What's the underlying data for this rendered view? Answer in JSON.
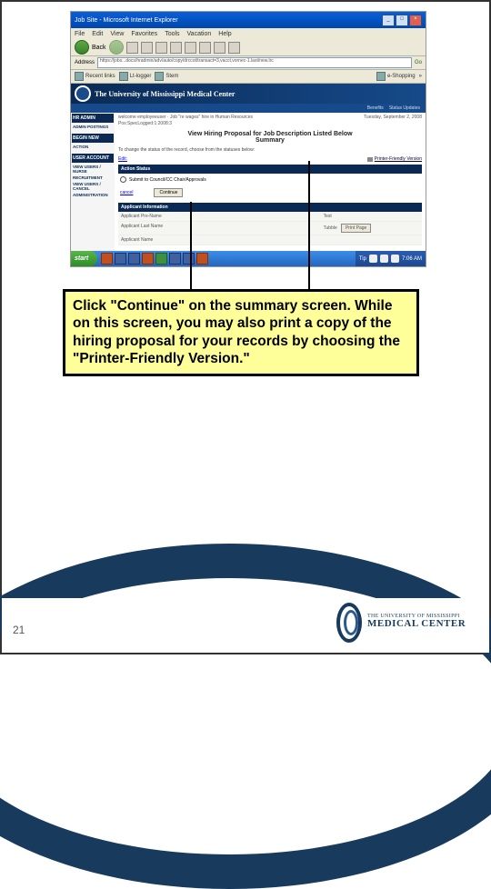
{
  "browser": {
    "title": "Job Site - Microsoft Internet Explorer",
    "menu": [
      "File",
      "Edit",
      "View",
      "Favorites",
      "Tools",
      "Vacation",
      "Help"
    ],
    "back": "Back",
    "address_label": "Address",
    "url": "https://jobs...docs/hradmin/adv/auto/copy/drccot/transact=3,vacct,vornec-1.last/new.lrc",
    "go": "Go",
    "links": {
      "recent": "Recent links",
      "logger": "Lt-logger",
      "stem": "Stem",
      "shopping": "e-Shopping"
    }
  },
  "page": {
    "banner": "The University of Mississippi Medical Center",
    "benefit": "Benefits",
    "status": "Status Updates",
    "sidebar": {
      "hrAdmin": "HR ADMIN",
      "adminPost": "ADMIN POSTINGS",
      "beginNew": "BEGIN NEW",
      "action": "ACTION",
      "userAccount": "USER ACCOUNT",
      "viewUser": "VIEW USERS / NURSE",
      "recruitment": "RECRUITMENT",
      "viewCancel": "VIEW USERS / CANCEL",
      "admin": "ADMINISTRATION"
    },
    "breadcrumb1": "welcome employeeuser · Job \"re wages\" hire in Human Resources",
    "breadcrumb2": "Pos:SpecLogged:1:2008:3",
    "date": "Tuesday, September 2, 2008",
    "title": "View Hiring Proposal for Job Description Listed Below",
    "subtitle": "Summary",
    "instructions": "To change the status of the record, choose from the statuses below:",
    "edit": "Edit:",
    "printer": "Printer-Friendly Version",
    "actionStatus": "Action Status",
    "actionOption": "Submit to Council/CC Chair/Approvals",
    "cancelLabel": "cancel",
    "continueBtn": "Continue",
    "appInfo": "Applicant Information",
    "rows": {
      "r1a": "Applicant Pre-Name",
      "r1c": "Test",
      "r2a": "Applicant Last Name",
      "r2c": "Tubble",
      "r3a": "Applicant Name"
    },
    "printPage": "Print Page"
  },
  "taskbar": {
    "start": "start",
    "time": "7:06 AM",
    "tip": "Tip"
  },
  "callout": "Click \"Continue\" on the summary screen. While on this screen, you may also print a copy of the hiring proposal for your records by choosing the \"Printer-Friendly Version.\"",
  "footer": {
    "pageNum": "21",
    "logoLine1": "THE UNIVERSITY OF MISSISSIPPI",
    "logoLine2": "MEDICAL CENTER"
  }
}
